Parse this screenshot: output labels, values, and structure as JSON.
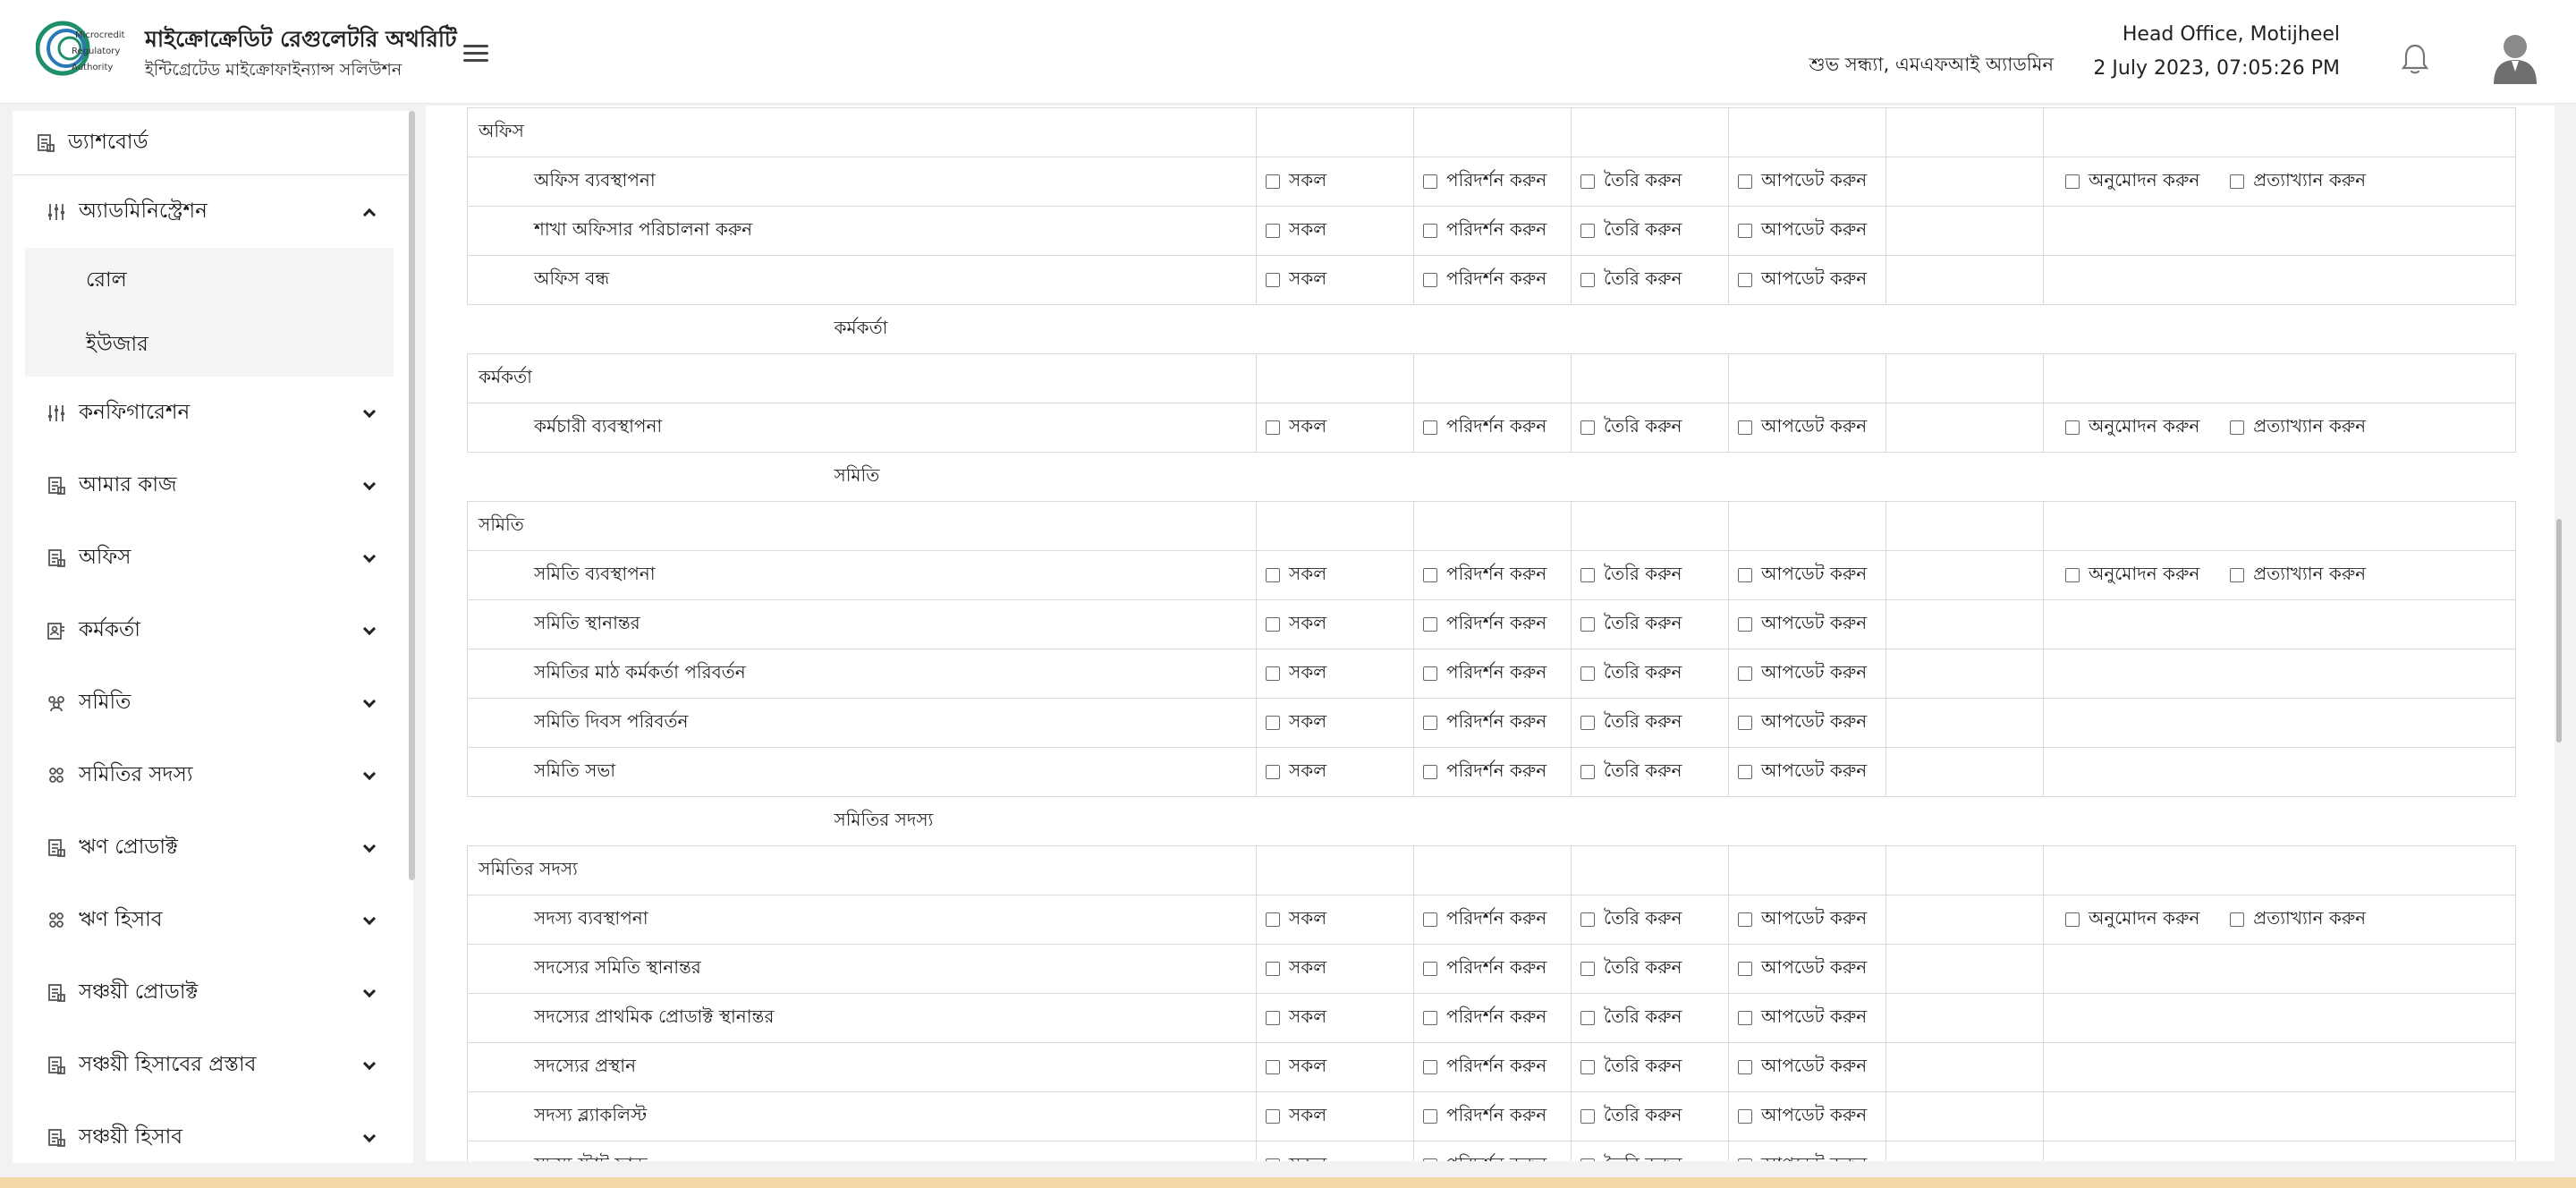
{
  "header": {
    "logo_text": [
      "Microcredit",
      "Regulatory",
      "Authority"
    ],
    "title": "মাইক্রোক্রেডিট রেগুলেটরি অথরিটি",
    "subtitle": "ইন্টিগ্রেটেড মাইক্রোফাইন্যান্স সলিউশন",
    "greeting": "শুভ সন্ধ্যা, এমএফআই অ্যাডমিন",
    "office": "Head Office, Motijheel",
    "datetime": "2 July 2023, 07:05:26 PM",
    "icons": [
      "menu-icon",
      "bell-icon",
      "user-avatar-icon"
    ]
  },
  "sidebar": {
    "dashboard": "ড্যাশবোর্ড",
    "items": [
      {
        "label": "অ্যাডমিনিস্ট্রেশন",
        "icon": "sliders-icon",
        "expanded": true,
        "children": [
          "রোল",
          "ইউজার"
        ]
      },
      {
        "label": "কনফিগারেশন",
        "icon": "sliders-icon"
      },
      {
        "label": "আমার কাজ",
        "icon": "document-icon"
      },
      {
        "label": "অফিস",
        "icon": "document-icon"
      },
      {
        "label": "কর্মকর্তা",
        "icon": "user-card-icon"
      },
      {
        "label": "সমিতি",
        "icon": "group-icon"
      },
      {
        "label": "সমিতির সদস্য",
        "icon": "members-icon"
      },
      {
        "label": "ঋণ প্রোডাক্ট",
        "icon": "document-icon"
      },
      {
        "label": "ঋণ হিসাব",
        "icon": "members-icon"
      },
      {
        "label": "সঞ্চয়ী প্রোডাক্ট",
        "icon": "document-icon"
      },
      {
        "label": "সঞ্চয়ী হিসাবের প্রস্তাব",
        "icon": "document-icon"
      },
      {
        "label": "সঞ্চয়ী হিসাব",
        "icon": "document-icon"
      }
    ]
  },
  "perm_labels": {
    "all": "সকল",
    "view": "পরিদর্শন করুন",
    "create": "তৈরি করুন",
    "update": "আপডেট করুন",
    "approve": "অনুমোদন করুন",
    "reject": "প্রত্যাখ্যান করুন"
  },
  "sections": [
    {
      "heading": "অফিস",
      "rows": [
        {
          "name": "অফিস ব্যবস্থাপনা",
          "approval": true
        },
        {
          "name": "শাখা অফিসার পরিচালনা করুন",
          "approval": false
        },
        {
          "name": "অফিস বন্ধ",
          "approval": false
        }
      ]
    },
    {
      "label": "কর্মকর্তা",
      "heading": "কর্মকর্তা",
      "rows": [
        {
          "name": "কর্মচারী ব্যবস্থাপনা",
          "approval": true
        }
      ]
    },
    {
      "label": "সমিতি",
      "heading": "সমিতি",
      "rows": [
        {
          "name": "সমিতি ব্যবস্থাপনা",
          "approval": true
        },
        {
          "name": "সমিতি স্থানান্তর",
          "approval": false
        },
        {
          "name": "সমিতির মাঠ কর্মকর্তা পরিবর্তন",
          "approval": false
        },
        {
          "name": "সমিতি দিবস পরিবর্তন",
          "approval": false
        },
        {
          "name": "সমিতি সভা",
          "approval": false
        }
      ]
    },
    {
      "label": "সমিতির সদস্য",
      "heading": "সমিতির সদস্য",
      "rows": [
        {
          "name": "সদস্য ব্যবস্থাপনা",
          "approval": true
        },
        {
          "name": "সদস্যের সমিতি স্থানান্তর",
          "approval": false
        },
        {
          "name": "সদস্যের প্রাথমিক প্রোডাক্ট স্থানান্তর",
          "approval": false
        },
        {
          "name": "সদস্যের প্রস্থান",
          "approval": false
        },
        {
          "name": "সদস্য ব্ল্যাকলিস্ট",
          "approval": false
        },
        {
          "name": "সদস্য স্টাট ফান্ড",
          "approval": false
        }
      ]
    }
  ]
}
